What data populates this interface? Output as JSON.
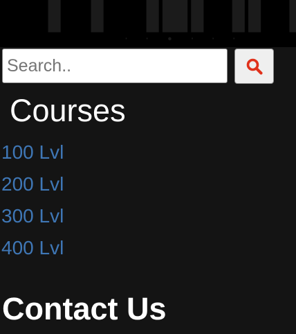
{
  "search": {
    "placeholder": "Search..",
    "value": "",
    "button_icon": "search-icon",
    "icon_color": "#e0311b"
  },
  "courses": {
    "title": "Courses",
    "items": [
      {
        "label": "100 Lvl"
      },
      {
        "label": "200 Lvl"
      },
      {
        "label": "300 Lvl"
      },
      {
        "label": "400 Lvl"
      }
    ],
    "link_color": "#3f77b6"
  },
  "contact": {
    "title": "Contact Us"
  },
  "colors": {
    "background": "#141414",
    "banner": "#000000",
    "heading": "#ffffff"
  }
}
